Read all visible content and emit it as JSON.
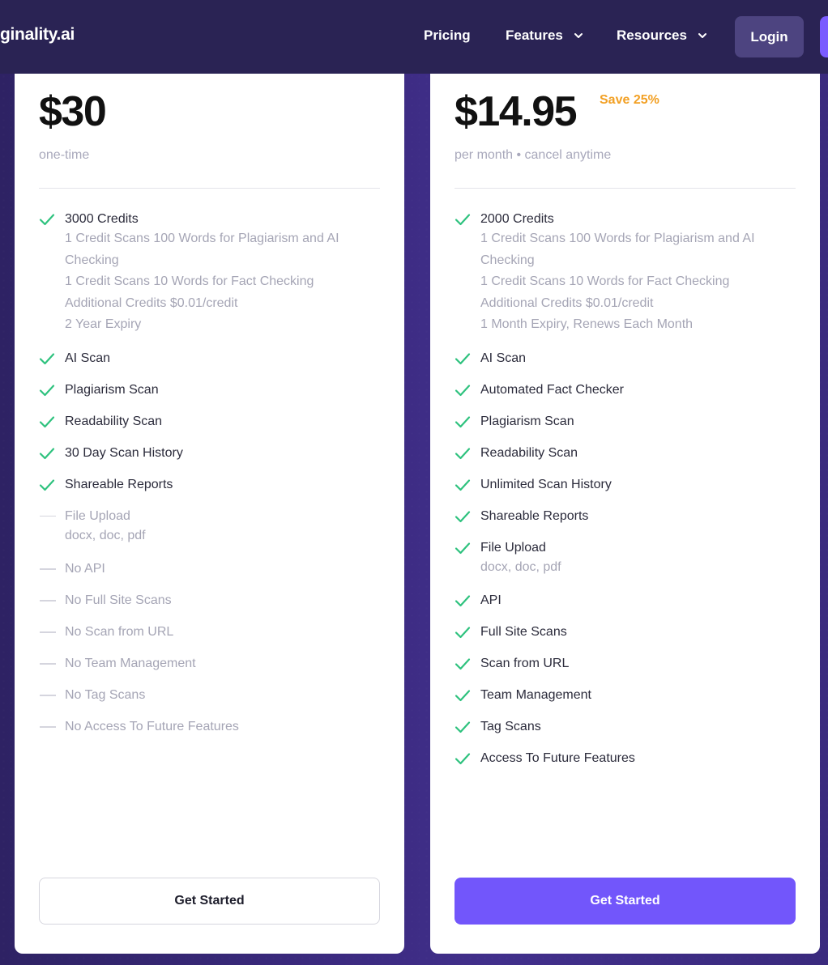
{
  "nav": {
    "logo": "ginality.ai",
    "links": [
      {
        "label": "Pricing",
        "dropdown": false
      },
      {
        "label": "Features",
        "dropdown": true
      },
      {
        "label": "Resources",
        "dropdown": true
      }
    ],
    "login": "Login"
  },
  "colors": {
    "nav_bg": "#2a2354",
    "accent": "#7256fb",
    "check": "#2ec27e",
    "save": "#f2a024"
  },
  "plans": [
    {
      "price": "$30",
      "save": "",
      "subtitle": "one-time",
      "cta": "Get Started",
      "features": [
        {
          "included": true,
          "title": "3000 Credits",
          "details": [
            "1 Credit Scans 100 Words for Plagiarism and AI Checking",
            "1 Credit Scans 10 Words for Fact Checking",
            "Additional Credits $0.01/credit",
            "2 Year Expiry"
          ]
        },
        {
          "included": true,
          "title": "AI Scan",
          "details": []
        },
        {
          "included": true,
          "title": "Plagiarism Scan",
          "details": []
        },
        {
          "included": true,
          "title": "Readability Scan",
          "details": []
        },
        {
          "included": true,
          "title": "30 Day Scan History",
          "details": []
        },
        {
          "included": true,
          "title": "Shareable Reports",
          "details": []
        },
        {
          "included": false,
          "title": "File Upload",
          "details": [
            "docx, doc, pdf"
          ]
        },
        {
          "included": false,
          "title": "No API",
          "details": []
        },
        {
          "included": false,
          "title": "No Full Site Scans",
          "details": []
        },
        {
          "included": false,
          "title": "No Scan from URL",
          "details": []
        },
        {
          "included": false,
          "title": "No Team Management",
          "details": []
        },
        {
          "included": false,
          "title": "No Tag Scans",
          "details": []
        },
        {
          "included": false,
          "title": "No Access To Future Features",
          "details": []
        }
      ]
    },
    {
      "price": "$14.95",
      "save": "Save 25%",
      "subtitle": "per month • cancel anytime",
      "cta": "Get Started",
      "features": [
        {
          "included": true,
          "title": "2000 Credits",
          "details": [
            "1 Credit Scans 100 Words for Plagiarism and AI Checking",
            "1 Credit Scans 10 Words for Fact Checking",
            "Additional Credits $0.01/credit",
            "1 Month Expiry, Renews Each Month"
          ]
        },
        {
          "included": true,
          "title": "AI Scan",
          "details": []
        },
        {
          "included": true,
          "title": "Automated Fact Checker",
          "details": []
        },
        {
          "included": true,
          "title": "Plagiarism Scan",
          "details": []
        },
        {
          "included": true,
          "title": "Readability Scan",
          "details": []
        },
        {
          "included": true,
          "title": "Unlimited Scan History",
          "details": []
        },
        {
          "included": true,
          "title": "Shareable Reports",
          "details": []
        },
        {
          "included": true,
          "title": "File Upload",
          "details": [
            "docx, doc, pdf"
          ]
        },
        {
          "included": true,
          "title": "API",
          "details": []
        },
        {
          "included": true,
          "title": "Full Site Scans",
          "details": []
        },
        {
          "included": true,
          "title": "Scan from URL",
          "details": []
        },
        {
          "included": true,
          "title": "Team Management",
          "details": []
        },
        {
          "included": true,
          "title": "Tag Scans",
          "details": []
        },
        {
          "included": true,
          "title": "Access To Future Features",
          "details": []
        }
      ]
    }
  ]
}
